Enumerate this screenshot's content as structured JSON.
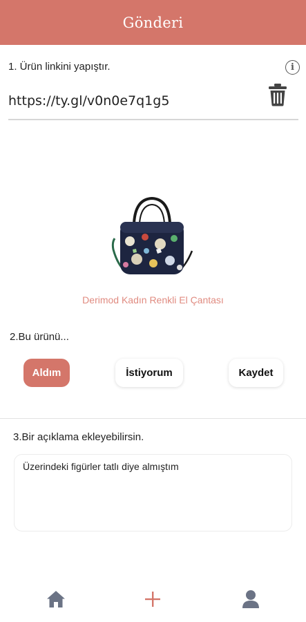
{
  "header": {
    "title": "Gönderi"
  },
  "step1": {
    "label": "1. Ürün linkini yapıştır.",
    "link_value": "https://ty.gl/v0n0e7q1g5"
  },
  "product": {
    "name": "Derimod Kadın Renkli El Çantası"
  },
  "step2": {
    "label": "2.Bu ürünü...",
    "options": [
      "Aldım",
      "İstiyorum",
      "Kaydet"
    ],
    "selected": "Aldım"
  },
  "step3": {
    "label": "3.Bir açıklama ekleyebilirsin.",
    "description": "Üzerindeki figürler tatlı diye almıştım"
  },
  "nav": {
    "items": [
      "home-icon",
      "add-icon",
      "profile-icon"
    ]
  },
  "colors": {
    "accent": "#d4766a",
    "product_name": "#e08b80",
    "icon_gray": "#6b7385"
  }
}
